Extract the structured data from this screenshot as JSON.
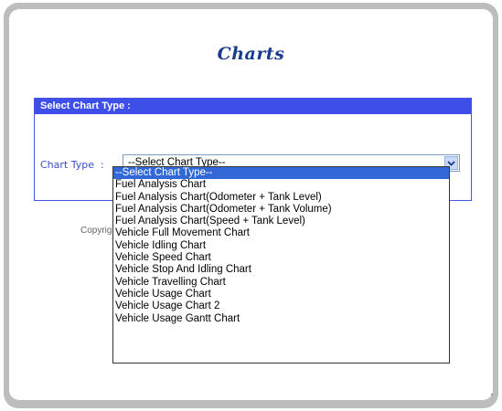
{
  "page": {
    "title": "Charts"
  },
  "panel": {
    "header": "Select Chart Type :",
    "chart_type_label": "Chart Type  :",
    "select_value": "--Select Chart Type--",
    "copyright_partial": "Copyrig"
  },
  "dropdown": {
    "selected_index": 0,
    "options": [
      "--Select Chart Type--",
      "Fuel Analysis Chart",
      "Fuel Analysis Chart(Odometer + Tank Level)",
      "Fuel Analysis Chart(Odometer + Tank Volume)",
      "Fuel Analysis Chart(Speed + Tank Level)",
      "Vehicle Full Movement Chart",
      "Vehicle Idling Chart",
      "Vehicle Speed Chart",
      "Vehicle Stop And Idling Chart",
      "Vehicle Travelling Chart",
      "Vehicle Usage Chart",
      "Vehicle Usage Chart 2",
      "Vehicle Usage Gantt Chart"
    ]
  },
  "colors": {
    "header_bg": "#3d4fe8",
    "title": "#1a3c8e",
    "selected_bg": "#3168d5"
  },
  "icons": {
    "select_arrow": "chevron-down-icon"
  }
}
